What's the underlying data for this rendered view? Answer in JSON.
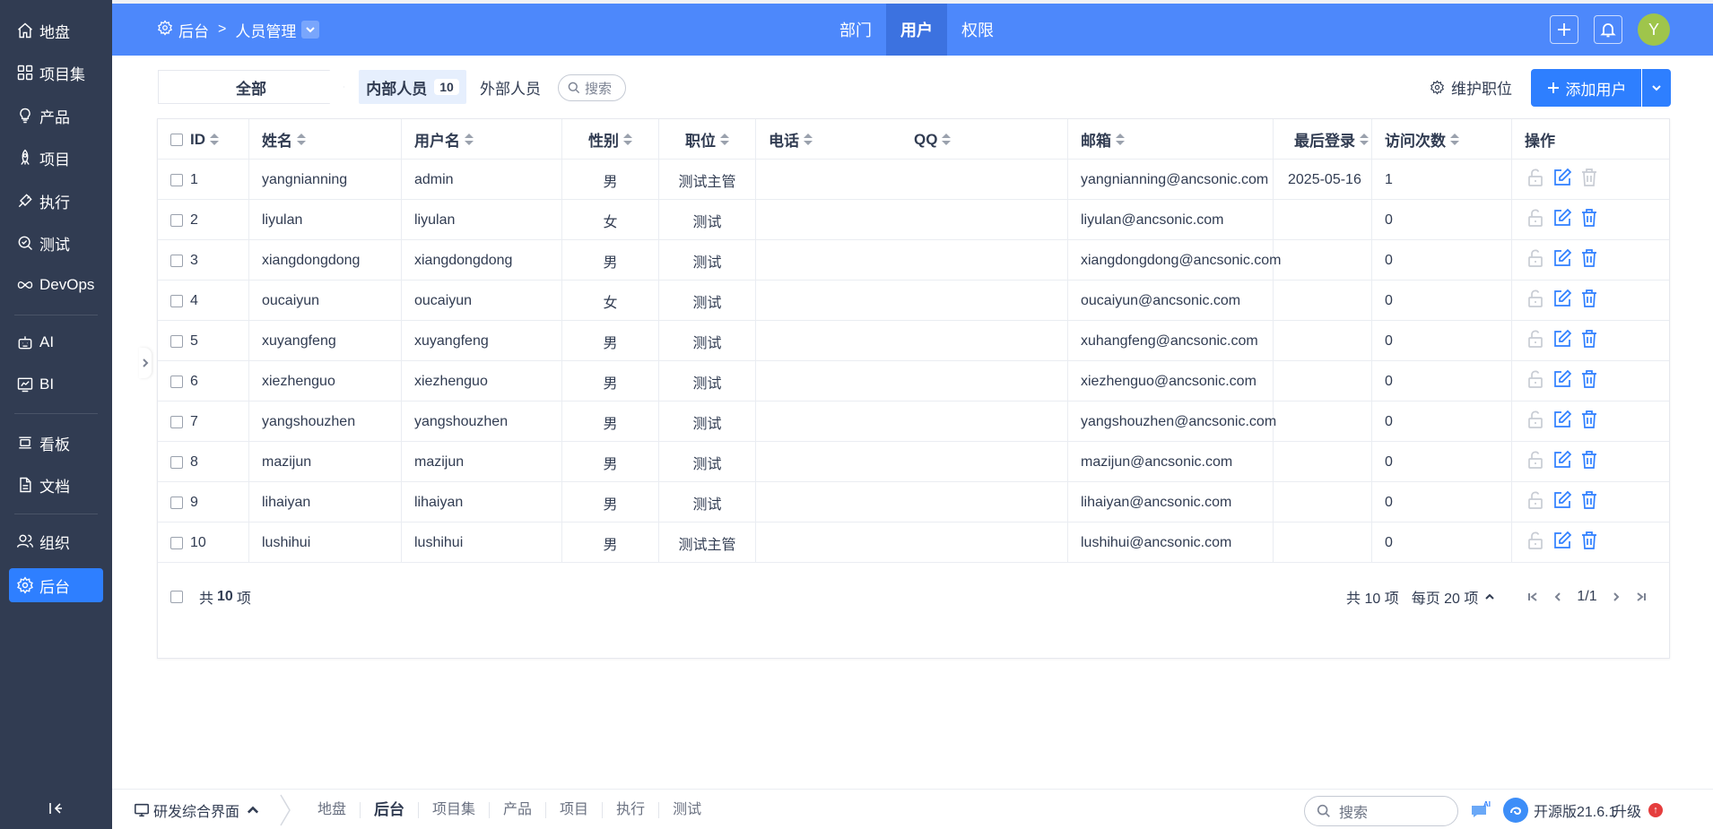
{
  "sidebar": {
    "items": [
      {
        "label": "地盘",
        "icon": "home-icon"
      },
      {
        "label": "项目集",
        "icon": "grid-icon"
      },
      {
        "label": "产品",
        "icon": "bulb-icon"
      },
      {
        "label": "项目",
        "icon": "rocket-icon"
      },
      {
        "label": "执行",
        "icon": "run-icon"
      },
      {
        "label": "测试",
        "icon": "test-icon"
      },
      {
        "label": "DevOps",
        "icon": "infinity-icon"
      },
      {
        "label": "AI",
        "icon": "robot-icon"
      },
      {
        "label": "BI",
        "icon": "chart-icon"
      },
      {
        "label": "看板",
        "icon": "kanban-icon"
      },
      {
        "label": "文档",
        "icon": "doc-icon"
      },
      {
        "label": "组织",
        "icon": "users-icon"
      },
      {
        "label": "后台",
        "icon": "gear-icon"
      }
    ],
    "active": "后台"
  },
  "header": {
    "breadcrumb_root": "后台",
    "breadcrumb_sep": ">",
    "breadcrumb_current": "人员管理",
    "tabs": [
      "部门",
      "用户",
      "权限"
    ],
    "active_tab": "用户",
    "avatar_letter": "Y",
    "accent": "#4d88fb"
  },
  "toolbar": {
    "all_label": "全部",
    "internal_label": "内部人员",
    "internal_count": "10",
    "external_label": "外部人员",
    "search_label": "搜索",
    "maintain_label": "维护职位",
    "add_user_label": "添加用户"
  },
  "table": {
    "columns": [
      "ID",
      "姓名",
      "用户名",
      "性别",
      "职位",
      "电话",
      "QQ",
      "邮箱",
      "最后登录",
      "访问次数",
      "操作"
    ],
    "rows": [
      {
        "id": "1",
        "name": "yangnianning",
        "username": "admin",
        "gender": "男",
        "position": "测试主管",
        "phone": "",
        "qq": "",
        "email": "yangnianning@ancsonic.com",
        "last_login": "2025-05-16",
        "visits": "1"
      },
      {
        "id": "2",
        "name": "liyulan",
        "username": "liyulan",
        "gender": "女",
        "position": "测试",
        "phone": "",
        "qq": "",
        "email": "liyulan@ancsonic.com",
        "last_login": "",
        "visits": "0"
      },
      {
        "id": "3",
        "name": "xiangdongdong",
        "username": "xiangdongdong",
        "gender": "男",
        "position": "测试",
        "phone": "",
        "qq": "",
        "email": "xiangdongdong@ancsonic.com",
        "last_login": "",
        "visits": "0"
      },
      {
        "id": "4",
        "name": "oucaiyun",
        "username": "oucaiyun",
        "gender": "女",
        "position": "测试",
        "phone": "",
        "qq": "",
        "email": "oucaiyun@ancsonic.com",
        "last_login": "",
        "visits": "0"
      },
      {
        "id": "5",
        "name": "xuyangfeng",
        "username": "xuyangfeng",
        "gender": "男",
        "position": "测试",
        "phone": "",
        "qq": "",
        "email": "xuhangfeng@ancsonic.com",
        "last_login": "",
        "visits": "0"
      },
      {
        "id": "6",
        "name": "xiezhenguo",
        "username": "xiezhenguo",
        "gender": "男",
        "position": "测试",
        "phone": "",
        "qq": "",
        "email": "xiezhenguo@ancsonic.com",
        "last_login": "",
        "visits": "0"
      },
      {
        "id": "7",
        "name": "yangshouzhen",
        "username": "yangshouzhen",
        "gender": "男",
        "position": "测试",
        "phone": "",
        "qq": "",
        "email": "yangshouzhen@ancsonic.com",
        "last_login": "",
        "visits": "0"
      },
      {
        "id": "8",
        "name": "mazijun",
        "username": "mazijun",
        "gender": "男",
        "position": "测试",
        "phone": "",
        "qq": "",
        "email": "mazijun@ancsonic.com",
        "last_login": "",
        "visits": "0"
      },
      {
        "id": "9",
        "name": "lihaiyan",
        "username": "lihaiyan",
        "gender": "男",
        "position": "测试",
        "phone": "",
        "qq": "",
        "email": "lihaiyan@ancsonic.com",
        "last_login": "",
        "visits": "0"
      },
      {
        "id": "10",
        "name": "lushihui",
        "username": "lushihui",
        "gender": "男",
        "position": "测试主管",
        "phone": "",
        "qq": "",
        "email": "lushihui@ancsonic.com",
        "last_login": "",
        "visits": "0"
      }
    ]
  },
  "footer": {
    "total_prefix": "共",
    "total_count": "10",
    "total_suffix": "项",
    "total_right": "共 10 项",
    "per_page": "每页 20 项",
    "page": "1/1"
  },
  "bottombar": {
    "ui_label": "研发综合界面",
    "tabs": [
      "地盘",
      "后台",
      "项目集",
      "产品",
      "项目",
      "执行",
      "测试"
    ],
    "active_tab": "后台",
    "search_label": "搜索",
    "version": "开源版21.6.1",
    "upgrade": "升级",
    "upgrade_badge": "↑",
    "ai_badge": "AI"
  }
}
